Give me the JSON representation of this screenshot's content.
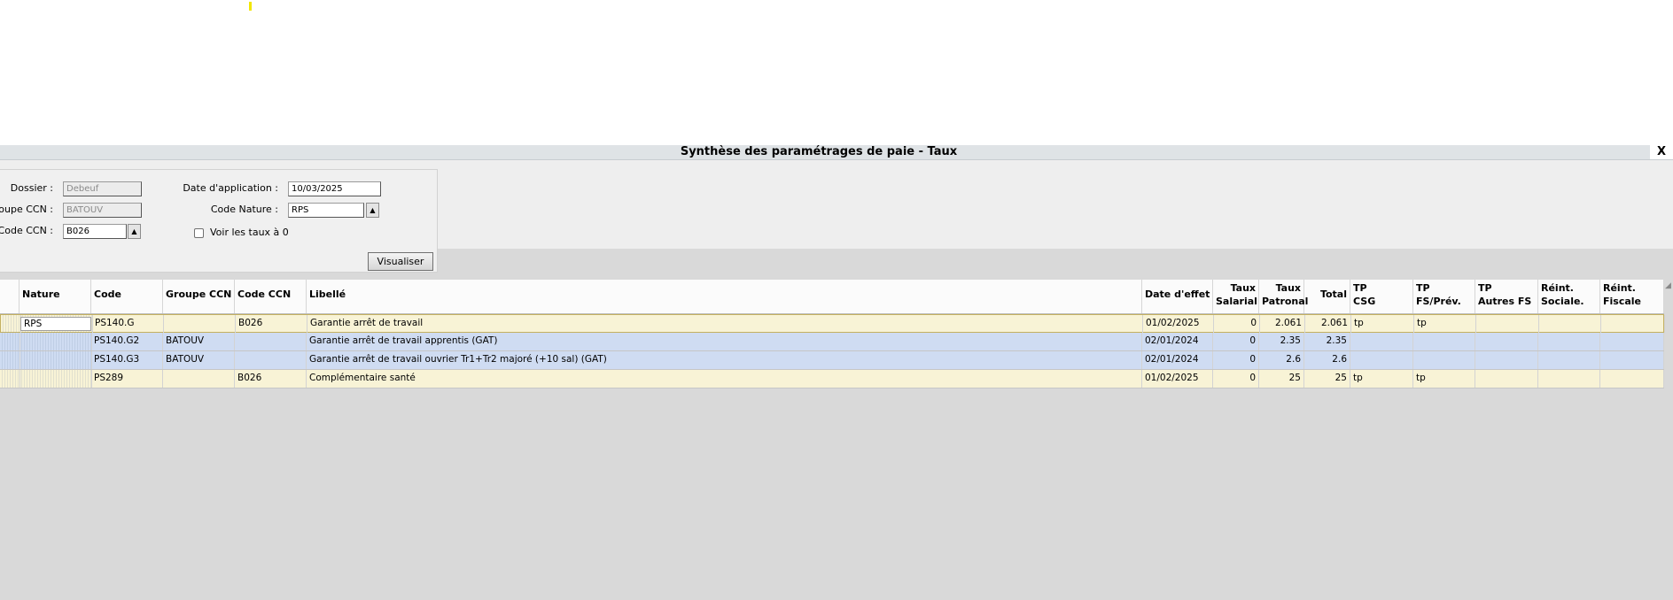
{
  "window": {
    "title": "Synthèse des paramétrages de paie - Taux",
    "close_label": "X"
  },
  "filters": {
    "dossier": {
      "label": "Dossier :",
      "value": "Debeuf"
    },
    "groupe_ccn": {
      "label": "Groupe CCN :",
      "value": "BATOUV"
    },
    "code_ccn": {
      "label": "Code CCN :",
      "value": "B026"
    },
    "date_application": {
      "label": "Date d'application :",
      "value": "10/03/2025"
    },
    "code_nature": {
      "label": "Code Nature :",
      "value": "RPS"
    },
    "voir_taux_zero": {
      "label": "Voir les taux à 0",
      "checked": false
    },
    "visualiser_label": "Visualiser",
    "spinner_glyph": "▲"
  },
  "grid": {
    "sort_glyph": "◢",
    "columns": [
      {
        "key": "nature",
        "label": "Nature"
      },
      {
        "key": "code",
        "label": "Code"
      },
      {
        "key": "groupe_ccn",
        "label": "Groupe CCN"
      },
      {
        "key": "code_ccn",
        "label": "Code CCN"
      },
      {
        "key": "libelle",
        "label": "Libellé"
      },
      {
        "key": "date_effet",
        "label": "Date d'effet"
      },
      {
        "key": "taux_salarial",
        "label": "Taux\nSalarial"
      },
      {
        "key": "taux_patronal",
        "label": "Taux\nPatronal"
      },
      {
        "key": "total",
        "label": "Total"
      },
      {
        "key": "tp_csg",
        "label": "TP\nCSG"
      },
      {
        "key": "tp_fs_prev",
        "label": "TP\nFS/Prév."
      },
      {
        "key": "tp_autres_fs",
        "label": "TP\nAutres FS"
      },
      {
        "key": "reint_sociale",
        "label": "Réint.\nSociale."
      },
      {
        "key": "reint_fiscale",
        "label": "Réint.\nFiscale"
      }
    ],
    "rows": [
      {
        "nature": "RPS",
        "code": "PS140.G",
        "groupe_ccn": "",
        "code_ccn": "B026",
        "libelle": "Garantie arrêt de travail",
        "date_effet": "01/02/2025",
        "taux_salarial": "0",
        "taux_patronal": "2.061",
        "total": "2.061",
        "tp_csg": "tp",
        "tp_fs_prev": "tp",
        "tp_autres_fs": "",
        "reint_sociale": "",
        "reint_fiscale": "",
        "style": "yellow",
        "selected": true
      },
      {
        "nature": "",
        "code": "PS140.G2",
        "groupe_ccn": "BATOUV",
        "code_ccn": "",
        "libelle": "Garantie arrêt de travail apprentis (GAT)",
        "date_effet": "02/01/2024",
        "taux_salarial": "0",
        "taux_patronal": "2.35",
        "total": "2.35",
        "tp_csg": "",
        "tp_fs_prev": "",
        "tp_autres_fs": "",
        "reint_sociale": "",
        "reint_fiscale": "",
        "style": "blue",
        "selected": false
      },
      {
        "nature": "",
        "code": "PS140.G3",
        "groupe_ccn": "BATOUV",
        "code_ccn": "",
        "libelle": "Garantie arrêt de travail ouvrier Tr1+Tr2  majoré (+10 sal) (GAT)",
        "date_effet": "02/01/2024",
        "taux_salarial": "0",
        "taux_patronal": "2.6",
        "total": "2.6",
        "tp_csg": "",
        "tp_fs_prev": "",
        "tp_autres_fs": "",
        "reint_sociale": "",
        "reint_fiscale": "",
        "style": "blue",
        "selected": false
      },
      {
        "nature": "",
        "code": "PS289",
        "groupe_ccn": "",
        "code_ccn": "B026",
        "libelle": "Complémentaire santé",
        "date_effet": "01/02/2025",
        "taux_salarial": "0",
        "taux_patronal": "25",
        "total": "25",
        "tp_csg": "tp",
        "tp_fs_prev": "tp",
        "tp_autres_fs": "",
        "reint_sociale": "",
        "reint_fiscale": "",
        "style": "yellow",
        "selected": false
      }
    ]
  }
}
